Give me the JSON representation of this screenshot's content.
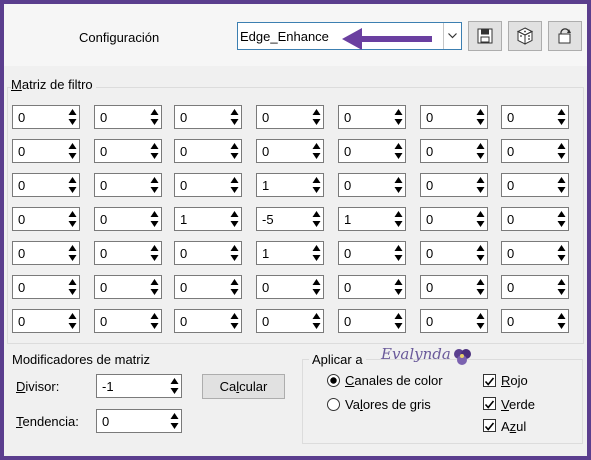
{
  "header": {
    "config_label": "Configuración",
    "preset_value": "Edge_Enhance",
    "save_tooltip_icon": "save-icon",
    "random_icon": "dice-icon",
    "reset_icon": "reset-icon",
    "accent_color": "#6a3fa0",
    "frame_color": "#5b3e8e"
  },
  "matrix": {
    "title_prefix": "M",
    "title_rest": "atriz de filtro",
    "rows": [
      [
        "0",
        "0",
        "0",
        "0",
        "0",
        "0",
        "0"
      ],
      [
        "0",
        "0",
        "0",
        "0",
        "0",
        "0",
        "0"
      ],
      [
        "0",
        "0",
        "0",
        "1",
        "0",
        "0",
        "0"
      ],
      [
        "0",
        "0",
        "1",
        "-5",
        "1",
        "0",
        "0"
      ],
      [
        "0",
        "0",
        "0",
        "1",
        "0",
        "0",
        "0"
      ],
      [
        "0",
        "0",
        "0",
        "0",
        "0",
        "0",
        "0"
      ],
      [
        "0",
        "0",
        "0",
        "0",
        "0",
        "0",
        "0"
      ]
    ]
  },
  "modifiers": {
    "title": "Modificadores de matriz",
    "divisor_prefix": "D",
    "divisor_rest": "ivisor:",
    "divisor_value": "-1",
    "bias_prefix": "T",
    "bias_rest": "endencia:",
    "bias_value": "0",
    "calc_pre": "Ca",
    "calc_u": "l",
    "calc_post": "cular"
  },
  "apply": {
    "title": "Aplicar a",
    "color_prefix": "C",
    "color_rest": "anales de color",
    "gray_pre": "Va",
    "gray_u": "l",
    "gray_post": "ores de gris",
    "red_prefix": "R",
    "red_rest": "ojo",
    "green_prefix": "V",
    "green_rest": "erde",
    "blue_pre": "A",
    "blue_u": "z",
    "blue_post": "ul",
    "watermark": "Evalynda"
  }
}
